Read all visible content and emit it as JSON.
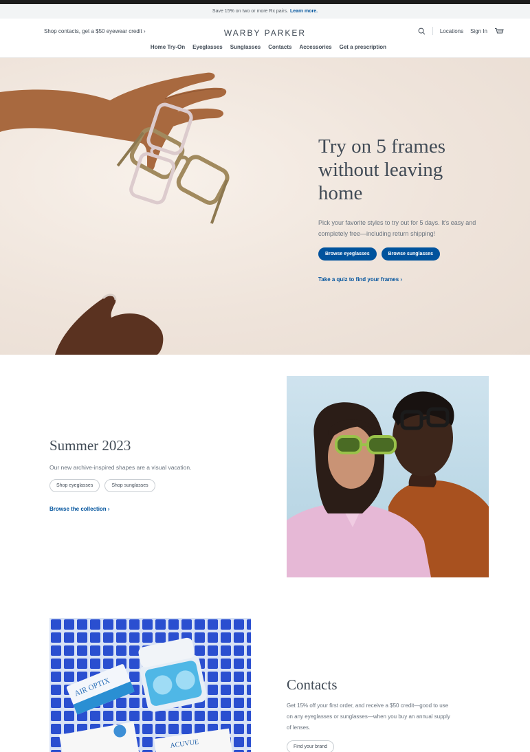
{
  "promo": {
    "text": "Save 15% on two or more Rx pairs.",
    "link": "Learn more."
  },
  "header": {
    "left_link": "Shop contacts, get a $50 eyewear credit ›",
    "logo": "WARBY PARKER",
    "search_icon": "search-icon",
    "locations": "Locations",
    "sign_in": "Sign In",
    "cart_icon": "cart-icon"
  },
  "nav": {
    "items": [
      "Home Try-On",
      "Eyeglasses",
      "Sunglasses",
      "Contacts",
      "Accessories",
      "Get a prescription"
    ]
  },
  "hero": {
    "title": "Try on 5 frames without leaving home",
    "description": "Pick your favorite styles to try out for 5 days. It's easy and completely free—including return shipping!",
    "btn_eyeglasses": "Browse eyeglasses",
    "btn_sunglasses": "Browse sunglasses",
    "quiz_link": "Take a quiz to find your frames ›"
  },
  "summer": {
    "title": "Summer 2023",
    "description": "Our new archive-inspired shapes are a visual vacation.",
    "btn_eyeglasses": "Shop eyeglasses",
    "btn_sunglasses": "Shop sunglasses",
    "collection_link": "Browse the collection ›"
  },
  "contacts": {
    "title": "Contacts",
    "description": "Get 15% off your first order, and receive a $50 credit—good to use on any eyeglasses or sunglasses—when you buy an annual supply of lenses.",
    "btn": "Find your brand",
    "box_label_1": "AIR OPTIX",
    "box_label_2": "ACUVUE"
  },
  "colors": {
    "brand_blue": "#00539d",
    "text": "#414b56",
    "hero_bg": "#efe4db",
    "tile_blue": "#2a4fd0"
  }
}
